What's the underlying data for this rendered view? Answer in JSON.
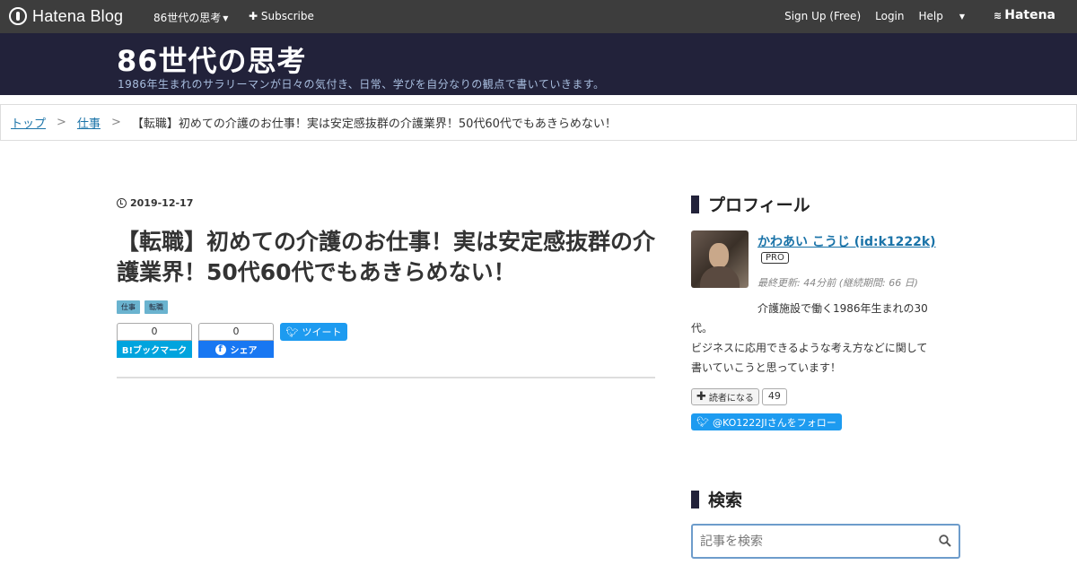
{
  "globalbar": {
    "logo_text": "Hatena Blog",
    "blog_menu_label": "86世代の思考",
    "subscribe_label": "Subscribe",
    "signup_label": "Sign Up (Free)",
    "login_label": "Login",
    "help_label": "Help",
    "hatena_label": "Hatena"
  },
  "header": {
    "title": "86世代の思考",
    "description": "1986年生まれのサラリーマンが日々の気付き、日常、学びを自分なりの観点で書いていきます。"
  },
  "breadcrumb": {
    "items": [
      "トップ",
      "仕事"
    ],
    "separator": ">",
    "current": "【転職】初めての介護のお仕事！実は安定感抜群の介護業界！50代60代でもあきらめない！"
  },
  "article": {
    "date": "2019-12-17",
    "title": "【転職】初めての介護のお仕事！実は安定感抜群の介護業界！50代60代でもあきらめない！",
    "categories": [
      "仕事",
      "転職"
    ],
    "share": {
      "hatena_count": "0",
      "hatena_label": "B!ブックマーク",
      "facebook_count": "0",
      "facebook_label": "シェア",
      "twitter_label": "ツイート"
    }
  },
  "sidebar": {
    "profile": {
      "heading": "プロフィール",
      "name": "かわあい こうじ (id:k1222k)",
      "badge": "PRO",
      "meta": "最終更新: 44分前 (継続期間: 66 日)",
      "desc_line1": "介護施設で働く1986年生まれの30",
      "desc_line2": "代。",
      "desc_line3": "ビジネスに応用できるような考え方などに関して",
      "desc_line4": "書いていこうと思っています！",
      "subscribe_label": "読者になる",
      "subscribe_count": "49",
      "follow_label": "@KO1222JIさんをフォロー"
    },
    "search": {
      "heading": "検索",
      "placeholder": "記事を検索"
    }
  },
  "colors": {
    "header_bg": "#22223a",
    "globalbar_bg": "#3d3d3d",
    "link": "#1a73a8",
    "category_bg": "#6ab3cf"
  }
}
